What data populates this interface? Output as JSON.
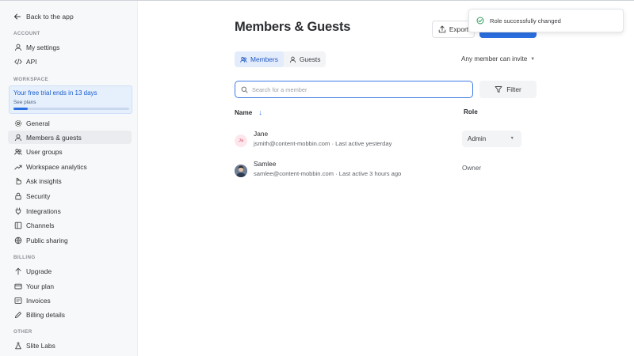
{
  "sidebar": {
    "back_label": "Back to the app",
    "sections": {
      "account": "ACCOUNT",
      "workspace": "WORKSPACE",
      "billing": "BILLING",
      "other": "OTHER"
    },
    "account_items": [
      {
        "label": "My settings",
        "icon": "user-icon"
      },
      {
        "label": "API",
        "icon": "code-icon"
      }
    ],
    "trial": {
      "title": "Your free trial ends in 13 days",
      "link": "See plans",
      "progress_fraction": 0.12
    },
    "workspace_items": [
      {
        "label": "General",
        "icon": "gear-icon"
      },
      {
        "label": "Members & guests",
        "icon": "user-icon",
        "active": true
      },
      {
        "label": "User groups",
        "icon": "users-icon"
      },
      {
        "label": "Workspace analytics",
        "icon": "trending-icon"
      },
      {
        "label": "Ask insights",
        "icon": "hand-icon"
      },
      {
        "label": "Security",
        "icon": "lock-icon"
      },
      {
        "label": "Integrations",
        "icon": "plug-icon"
      },
      {
        "label": "Channels",
        "icon": "columns-icon"
      },
      {
        "label": "Public sharing",
        "icon": "globe-icon"
      }
    ],
    "billing_items": [
      {
        "label": "Upgrade",
        "icon": "arrow-up-icon"
      },
      {
        "label": "Your plan",
        "icon": "card-icon"
      },
      {
        "label": "Invoices",
        "icon": "invoice-icon"
      },
      {
        "label": "Billing details",
        "icon": "pencil-icon"
      }
    ],
    "other_items": [
      {
        "label": "Slite Labs",
        "icon": "flask-icon"
      }
    ]
  },
  "header": {
    "title": "Members & Guests",
    "export_label": "Export"
  },
  "toast": {
    "message": "Role successfully changed"
  },
  "tabs": [
    {
      "label": "Members",
      "icon": "members-icon",
      "active": true
    },
    {
      "label": "Guests",
      "icon": "guest-icon",
      "active": false
    }
  ],
  "invite_select": {
    "value": "Any member can invite"
  },
  "search": {
    "placeholder": "Search for a member"
  },
  "filter_label": "Filter",
  "table": {
    "col_name": "Name",
    "col_role": "Role",
    "sort_glyph": "↓",
    "rows": [
      {
        "initials": "Ja",
        "name": "Jane",
        "email": "jsmith@content-mobbin.com",
        "last_active": "Last active yesterday",
        "role": "Admin"
      },
      {
        "initials": "",
        "name": "Samlee",
        "email": "samlee@content-mobbin.com",
        "last_active": "Last active 3 hours ago",
        "role": "Owner"
      }
    ]
  },
  "colors": {
    "accent": "#2b6fe0",
    "toast_success": "#2e9c5a"
  }
}
